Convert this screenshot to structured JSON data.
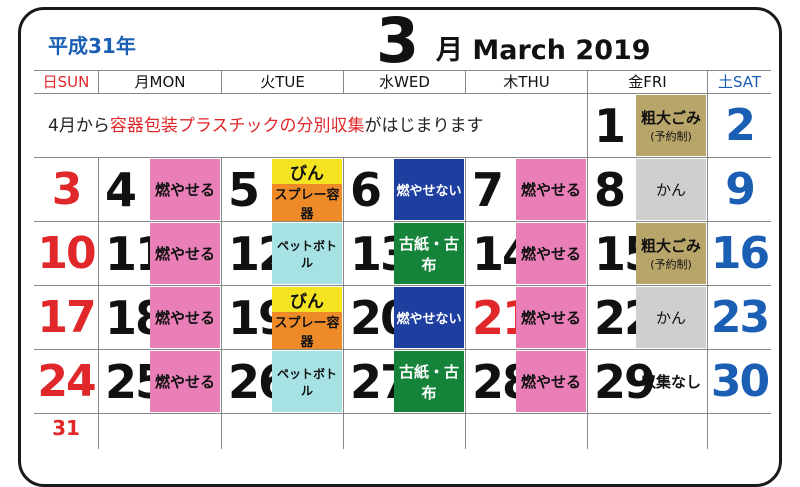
{
  "era": "平成31年",
  "month_number": "3",
  "month_title": "月 March 2019",
  "weekdays": [
    "日SUN",
    "月MON",
    "火TUE",
    "水WED",
    "木THU",
    "金FRI",
    "土SAT"
  ],
  "notice": {
    "prefix": "4月から",
    "highlight": "容器包装プラスチックの分別収集",
    "suffix": "がはじまります"
  },
  "days": {
    "d1": "1",
    "d2": "2",
    "d3": "3",
    "d4": "4",
    "d5": "5",
    "d6": "6",
    "d7": "7",
    "d8": "8",
    "d9": "9",
    "d10": "10",
    "d11": "11",
    "d12": "12",
    "d13": "13",
    "d14": "14",
    "d15": "15",
    "d16": "16",
    "d17": "17",
    "d18": "18",
    "d19": "19",
    "d20": "20",
    "d21": "21",
    "d22": "22",
    "d23": "23",
    "d24": "24",
    "d25": "25",
    "d26": "26",
    "d27": "27",
    "d28": "28",
    "d29": "29",
    "d30": "30",
    "d31": "31"
  },
  "labels": {
    "burnable": "燃やせる",
    "non_burnable": "燃やせない",
    "bin": "びん",
    "spray": "スプレー容器",
    "pet": "ペットボトル",
    "paper": "古紙・古布",
    "bulky": "粗大ごみ",
    "bulky_note": "(予約制)",
    "can": "かん",
    "no_collection": "収集なし"
  },
  "colors": {
    "burnable": "#ea7fb8",
    "non_burnable": "#1e3fa0",
    "bin": "#f4e320",
    "spray": "#ef8a28",
    "pet": "#a6e1e3",
    "paper": "#16833b",
    "bulky": "#b8a56a",
    "can": "#cfcfcf",
    "sunday": "#e0282a",
    "saturday": "#1a5fb4"
  }
}
